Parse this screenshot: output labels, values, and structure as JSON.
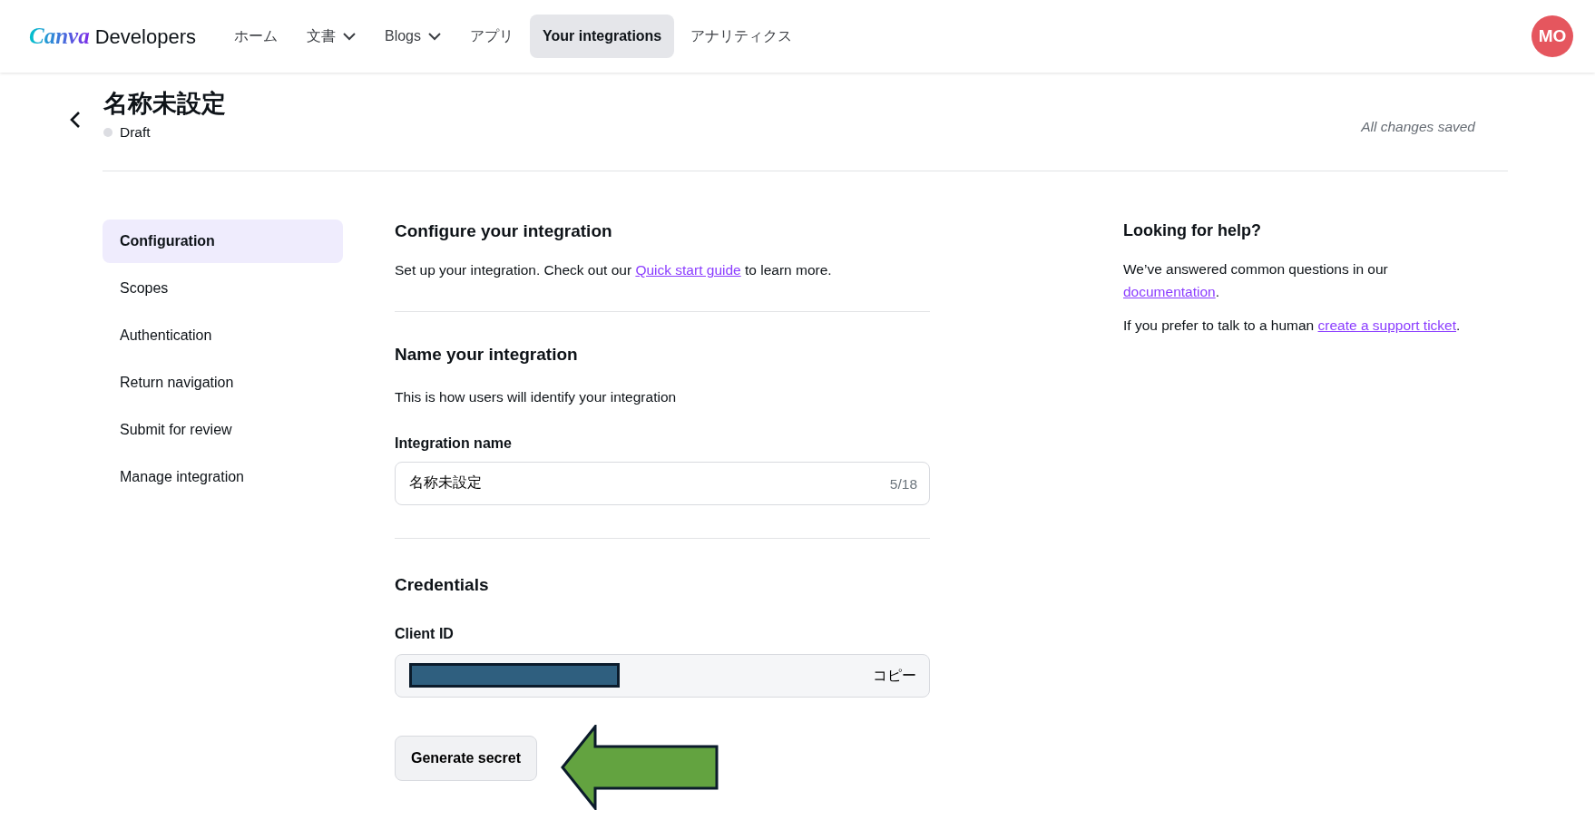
{
  "header": {
    "logo_mark": "Canva",
    "logo_text": "Developers",
    "nav": [
      {
        "label": "ホーム",
        "kind": "link",
        "selected": false
      },
      {
        "label": "文書",
        "kind": "dropdown",
        "selected": false
      },
      {
        "label": "Blogs",
        "kind": "dropdown",
        "selected": false
      },
      {
        "label": "アプリ",
        "kind": "link",
        "selected": false
      },
      {
        "label": "Your integrations",
        "kind": "link",
        "selected": true
      },
      {
        "label": "アナリティクス",
        "kind": "link",
        "selected": false
      }
    ],
    "avatar": "MO"
  },
  "page": {
    "title": "名称未設定",
    "status": "Draft",
    "save_state": "All changes saved"
  },
  "sidebar": {
    "items": [
      {
        "label": "Configuration",
        "selected": true
      },
      {
        "label": "Scopes",
        "selected": false
      },
      {
        "label": "Authentication",
        "selected": false
      },
      {
        "label": "Return navigation",
        "selected": false
      },
      {
        "label": "Submit for review",
        "selected": false
      },
      {
        "label": "Manage integration",
        "selected": false
      }
    ]
  },
  "main": {
    "heading": "Configure your integration",
    "intro": {
      "before": "Set up your integration. Check out our ",
      "link": "Quick start guide",
      "after": " to learn more."
    },
    "name_section": {
      "heading": "Name your integration",
      "description": "This is how users will identify your integration",
      "field_label": "Integration name",
      "value": "名称未設定",
      "counter": "5/18"
    },
    "credentials": {
      "heading": "Credentials",
      "field_label": "Client ID",
      "copy": "コピー",
      "button": "Generate secret"
    }
  },
  "help": {
    "heading": "Looking for help?",
    "paragraphs": [
      {
        "before": "We’ve answered common questions in our ",
        "link": "documentation",
        "after": "."
      },
      {
        "before": "If you prefer to talk to a human ",
        "link": "create a support ticket",
        "after": "."
      }
    ]
  }
}
